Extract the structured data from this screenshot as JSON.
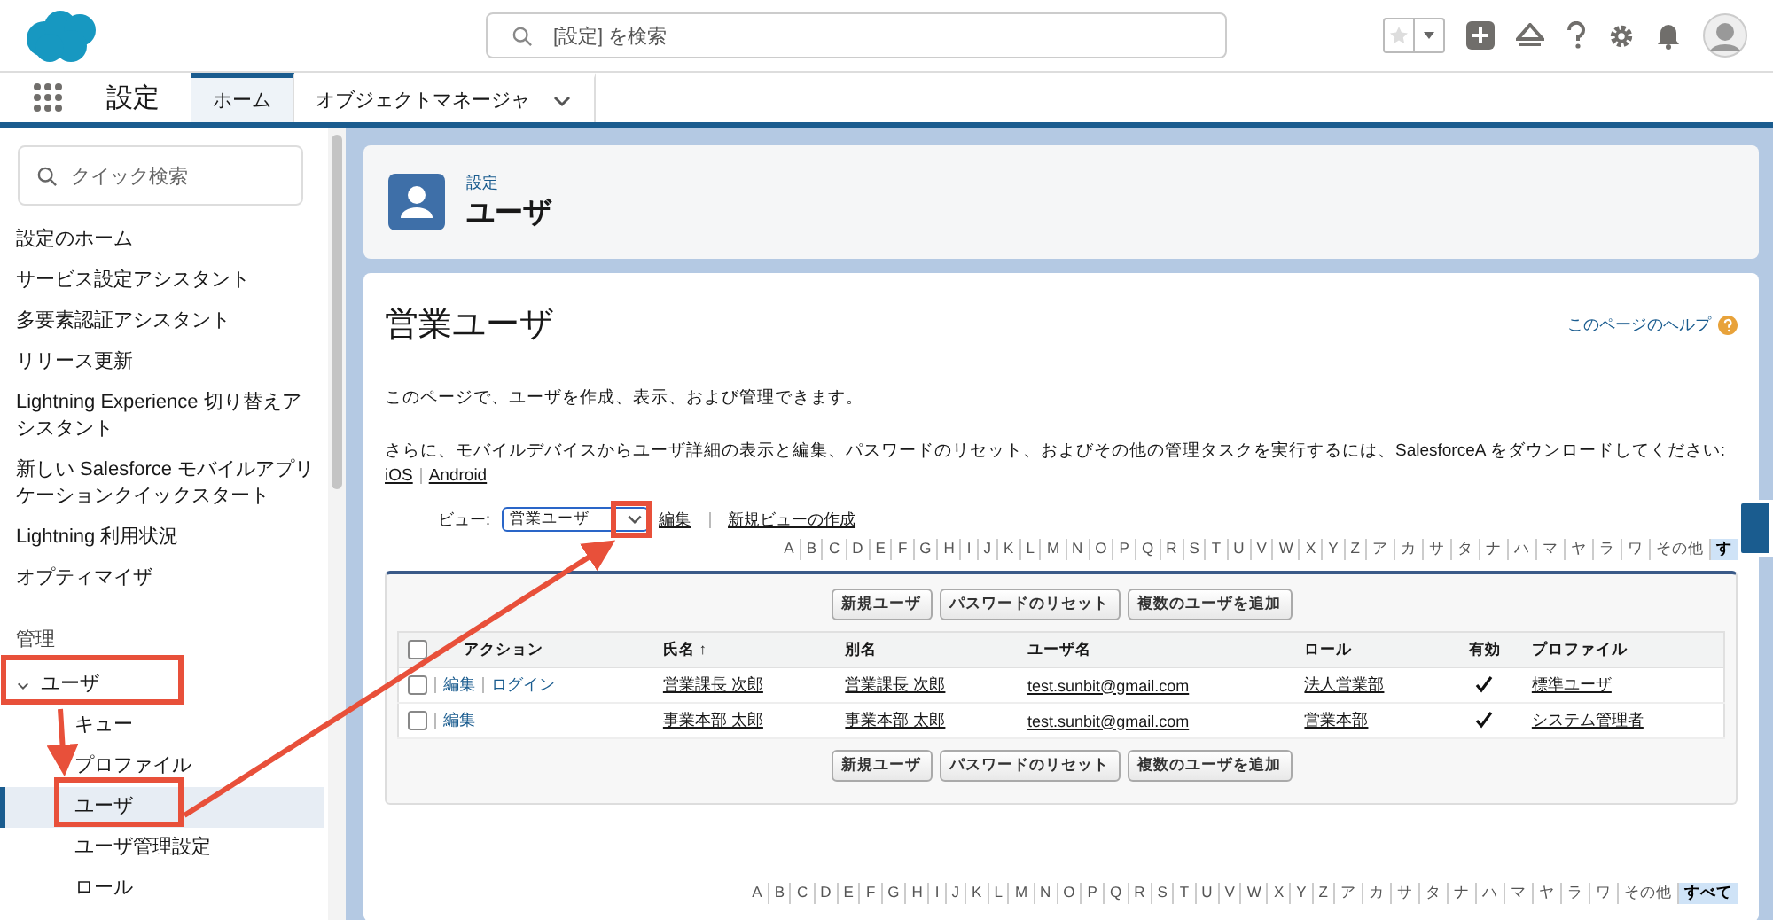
{
  "header": {
    "search_placeholder": "[設定] を検索"
  },
  "nav": {
    "app_title": "設定",
    "tabs": [
      {
        "label": "ホーム",
        "selected": true,
        "has_menu": false
      },
      {
        "label": "オブジェクトマネージャ",
        "selected": false,
        "has_menu": true
      }
    ]
  },
  "sidebar": {
    "search_placeholder": "クイック検索",
    "items": [
      {
        "kind": "link",
        "label": "設定のホーム"
      },
      {
        "kind": "link",
        "label": "サービス設定アシスタント"
      },
      {
        "kind": "link",
        "label": "多要素認証アシスタント"
      },
      {
        "kind": "link",
        "label": "リリース更新"
      },
      {
        "kind": "link",
        "label": "Lightning Experience 切り替えアシスタント"
      },
      {
        "kind": "link",
        "label": "新しい Salesforce モバイルアプリケーションクイックスタート"
      },
      {
        "kind": "link",
        "label": "Lightning 利用状況"
      },
      {
        "kind": "link",
        "label": "オプティマイザ"
      },
      {
        "kind": "section",
        "label": "管理"
      },
      {
        "kind": "group",
        "label": "ユーザ",
        "expanded": true,
        "children": [
          {
            "label": "キュー",
            "selected": false
          },
          {
            "label": "プロファイル",
            "selected": false
          },
          {
            "label": "ユーザ",
            "selected": true
          },
          {
            "label": "ユーザ管理設定",
            "selected": false
          },
          {
            "label": "ロール",
            "selected": false
          }
        ]
      }
    ]
  },
  "page_header": {
    "breadcrumb": "設定",
    "title": "ユーザ"
  },
  "content": {
    "title": "営業ユーザ",
    "help_link": "このページのヘルプ",
    "intro": "このページで、ユーザを作成、表示、および管理できます。",
    "description": "さらに、モバイルデバイスからユーザ詳細の表示と編集、パスワードのリセット、およびその他の管理タスクを実行するには、SalesforceA をダウンロードしてください: ",
    "description_links": [
      "iOS",
      "Android"
    ],
    "view": {
      "label": "ビュー:",
      "value": "営業ユーザ",
      "links": [
        "編集",
        "新規ビューの作成"
      ]
    },
    "alphabet_top": [
      {
        "label": "A",
        "selected": false
      },
      {
        "label": "B",
        "selected": false
      },
      {
        "label": "C",
        "selected": false
      },
      {
        "label": "D",
        "selected": false
      },
      {
        "label": "E",
        "selected": false
      },
      {
        "label": "F",
        "selected": false
      },
      {
        "label": "G",
        "selected": false
      },
      {
        "label": "H",
        "selected": false
      },
      {
        "label": "I",
        "selected": false
      },
      {
        "label": "J",
        "selected": false
      },
      {
        "label": "K",
        "selected": false
      },
      {
        "label": "L",
        "selected": false
      },
      {
        "label": "M",
        "selected": false
      },
      {
        "label": "N",
        "selected": false
      },
      {
        "label": "O",
        "selected": false
      },
      {
        "label": "P",
        "selected": false
      },
      {
        "label": "Q",
        "selected": false
      },
      {
        "label": "R",
        "selected": false
      },
      {
        "label": "S",
        "selected": false
      },
      {
        "label": "T",
        "selected": false
      },
      {
        "label": "U",
        "selected": false
      },
      {
        "label": "V",
        "selected": false
      },
      {
        "label": "W",
        "selected": false
      },
      {
        "label": "X",
        "selected": false
      },
      {
        "label": "Y",
        "selected": false
      },
      {
        "label": "Z",
        "selected": false
      },
      {
        "label": "ア",
        "selected": false
      },
      {
        "label": "カ",
        "selected": false
      },
      {
        "label": "サ",
        "selected": false
      },
      {
        "label": "タ",
        "selected": false
      },
      {
        "label": "ナ",
        "selected": false
      },
      {
        "label": "ハ",
        "selected": false
      },
      {
        "label": "マ",
        "selected": false
      },
      {
        "label": "ヤ",
        "selected": false
      },
      {
        "label": "ラ",
        "selected": false
      },
      {
        "label": "ワ",
        "selected": false
      },
      {
        "label": "その他",
        "selected": false
      },
      {
        "label": "す",
        "selected": true
      }
    ],
    "buttons_top": [
      "新規ユーザ",
      "パスワードのリセット",
      "複数のユーザを追加"
    ],
    "select_all_checked": false,
    "columns": [
      "アクション",
      "氏名 ↑",
      "別名",
      "ユーザ名",
      "ロール",
      "有効",
      "プロファイル"
    ],
    "rows": [
      {
        "checked": false,
        "actions": [
          "編集",
          "ログイン"
        ],
        "name": "営業課長 次郎",
        "alias": "営業課長 次郎",
        "username": "test.sunbit@gmail.com",
        "role": "法人営業部",
        "active": true,
        "profile": "標準ユーザ"
      },
      {
        "checked": false,
        "actions": [
          "編集"
        ],
        "name": "事業本部 太郎",
        "alias": "事業本部 太郎",
        "username": "test.sunbit@gmail.com",
        "role": "営業本部",
        "active": true,
        "profile": "システム管理者"
      }
    ],
    "buttons_bottom": [
      "新規ユーザ",
      "パスワードのリセット",
      "複数のユーザを追加"
    ],
    "alphabet_bottom": [
      {
        "label": "A",
        "selected": false
      },
      {
        "label": "B",
        "selected": false
      },
      {
        "label": "C",
        "selected": false
      },
      {
        "label": "D",
        "selected": false
      },
      {
        "label": "E",
        "selected": false
      },
      {
        "label": "F",
        "selected": false
      },
      {
        "label": "G",
        "selected": false
      },
      {
        "label": "H",
        "selected": false
      },
      {
        "label": "I",
        "selected": false
      },
      {
        "label": "J",
        "selected": false
      },
      {
        "label": "K",
        "selected": false
      },
      {
        "label": "L",
        "selected": false
      },
      {
        "label": "M",
        "selected": false
      },
      {
        "label": "N",
        "selected": false
      },
      {
        "label": "O",
        "selected": false
      },
      {
        "label": "P",
        "selected": false
      },
      {
        "label": "Q",
        "selected": false
      },
      {
        "label": "R",
        "selected": false
      },
      {
        "label": "S",
        "selected": false
      },
      {
        "label": "T",
        "selected": false
      },
      {
        "label": "U",
        "selected": false
      },
      {
        "label": "V",
        "selected": false
      },
      {
        "label": "W",
        "selected": false
      },
      {
        "label": "X",
        "selected": false
      },
      {
        "label": "Y",
        "selected": false
      },
      {
        "label": "Z",
        "selected": false
      },
      {
        "label": "ア",
        "selected": false
      },
      {
        "label": "カ",
        "selected": false
      },
      {
        "label": "サ",
        "selected": false
      },
      {
        "label": "タ",
        "selected": false
      },
      {
        "label": "ナ",
        "selected": false
      },
      {
        "label": "ハ",
        "selected": false
      },
      {
        "label": "マ",
        "selected": false
      },
      {
        "label": "ヤ",
        "selected": false
      },
      {
        "label": "ラ",
        "selected": false
      },
      {
        "label": "ワ",
        "selected": false
      },
      {
        "label": "その他",
        "selected": false
      },
      {
        "label": "すべて",
        "selected": true
      }
    ]
  }
}
